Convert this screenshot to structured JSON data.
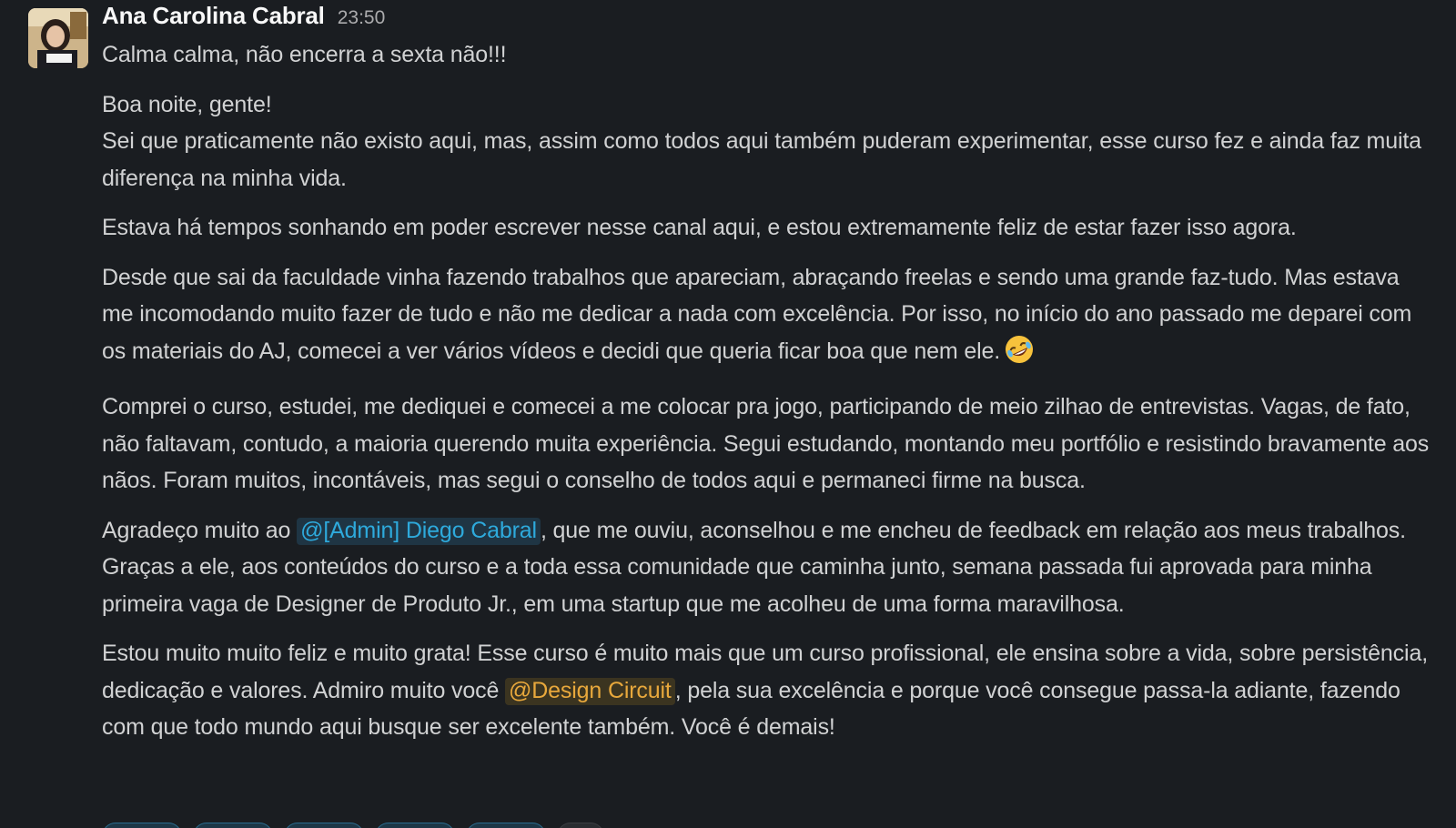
{
  "message": {
    "author": "Ana Carolina Cabral",
    "time": "23:50",
    "avatar_icon": "user-photo-avatar",
    "lines": {
      "p1": "Calma calma, não encerra a sexta não!!!",
      "p2a": "Boa noite, gente!",
      "p2b": "Sei que praticamente não existo aqui, mas, assim como todos aqui também puderam experimentar, esse curso fez e ainda faz muita diferença na minha vida.",
      "p3": "Estava há tempos sonhando em poder escrever nesse canal aqui, e estou extremamente feliz de estar fazer isso agora.",
      "p4": "Desde que sai da faculdade vinha fazendo trabalhos que apareciam, abraçando freelas e sendo uma grande faz-tudo. Mas estava me incomodando muito fazer de tudo e não me dedicar a nada com excelência. Por isso, no início do ano passado me deparei com os materiais do AJ, comecei a ver vários vídeos e decidi que queria ficar boa que nem ele.",
      "p4_emoji": "rolling-on-floor-laughing-emoji",
      "p5": "Comprei o curso, estudei, me dediquei e comecei a me colocar pra jogo, participando de meio zilhao de entrevistas. Vagas, de fato, não faltavam, contudo, a maioria querendo muita experiência.  Segui estudando, montando meu portfólio e resistindo bravamente aos nãos. Foram muitos, incontáveis, mas segui o conselho de todos aqui e permaneci firme na busca.",
      "p6_before": "Agradeço muito ao ",
      "p6_mention": "@[Admin] Diego Cabral",
      "p6_after": ", que me ouviu, aconselhou e me encheu de feedback em relação aos meus trabalhos. Graças a ele, aos conteúdos do curso e a toda essa comunidade que caminha junto, semana passada fui aprovada para minha primeira vaga de Designer de Produto Jr., em uma startup que me acolheu de uma forma maravilhosa.",
      "p7_before": "Estou muito muito feliz e muito grata! Esse curso é muito mais que um curso profissional, ele ensina sobre a vida, sobre persistência, dedicação e valores. Admiro muito você ",
      "p7_mention": "@Design Circuit",
      "p7_after": ", pela sua excelência e porque você consegue passa-la adiante, fazendo com que todo mundo aqui busque ser excelente também. Você é demais!"
    }
  },
  "colors": {
    "background": "#1a1d21",
    "text": "#d1d2d3",
    "author": "#f8f8f8",
    "timestamp": "#ababad",
    "mention_user": "#2eaadc",
    "mention_user_bg": "#1f3544",
    "mention_group": "#e8a83c",
    "mention_group_bg": "#3b3420"
  }
}
